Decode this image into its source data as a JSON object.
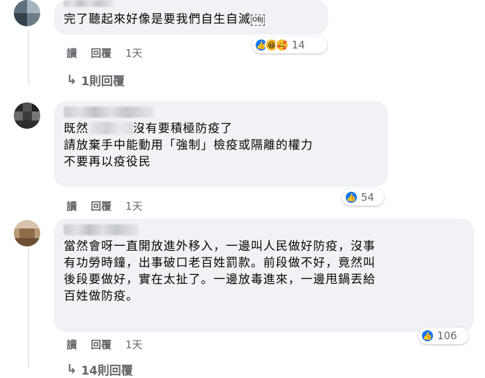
{
  "comments": [
    {
      "lines": [
        "完了聽起來好像是要我們自生自滅"
      ],
      "emoji_box": "OBJ",
      "reaction_count": "14",
      "actions": {
        "read": "讀",
        "reply": "回覆",
        "time": "1天"
      },
      "replies_label": "1則回覆"
    },
    {
      "lines_1_prefix": "既然",
      "lines_1_suffix": "沒有要積極防疫了",
      "lines": [
        "請放棄手中能動用「強制」檢疫或隔離的權力",
        "不要再以疫役民"
      ],
      "reaction_count": "54",
      "actions": {
        "read": "讀",
        "reply": "回覆",
        "time": "1天"
      }
    },
    {
      "lines": [
        "當然會呀一直開放進外移入，一邊叫人民做好防疫，沒事",
        "有功勞時鐘，出事破口老百姓罰款。前段做不好，竟然叫",
        "後段要做好，實在太扯了。一邊放毒進來，一邊甩鍋丟給",
        "百姓做防疫。"
      ],
      "reaction_count": "106",
      "actions": {
        "read": "讀",
        "reply": "回覆",
        "time": "1天"
      },
      "replies_label": "14則回覆"
    }
  ],
  "colors": {
    "like_blue": "#1877f2",
    "bubble_bg": "#f0f2f5",
    "meta_gray": "#65676b"
  },
  "icons": [
    "like-icon",
    "haha-icon",
    "care-icon",
    "reply-arrow-icon"
  ]
}
